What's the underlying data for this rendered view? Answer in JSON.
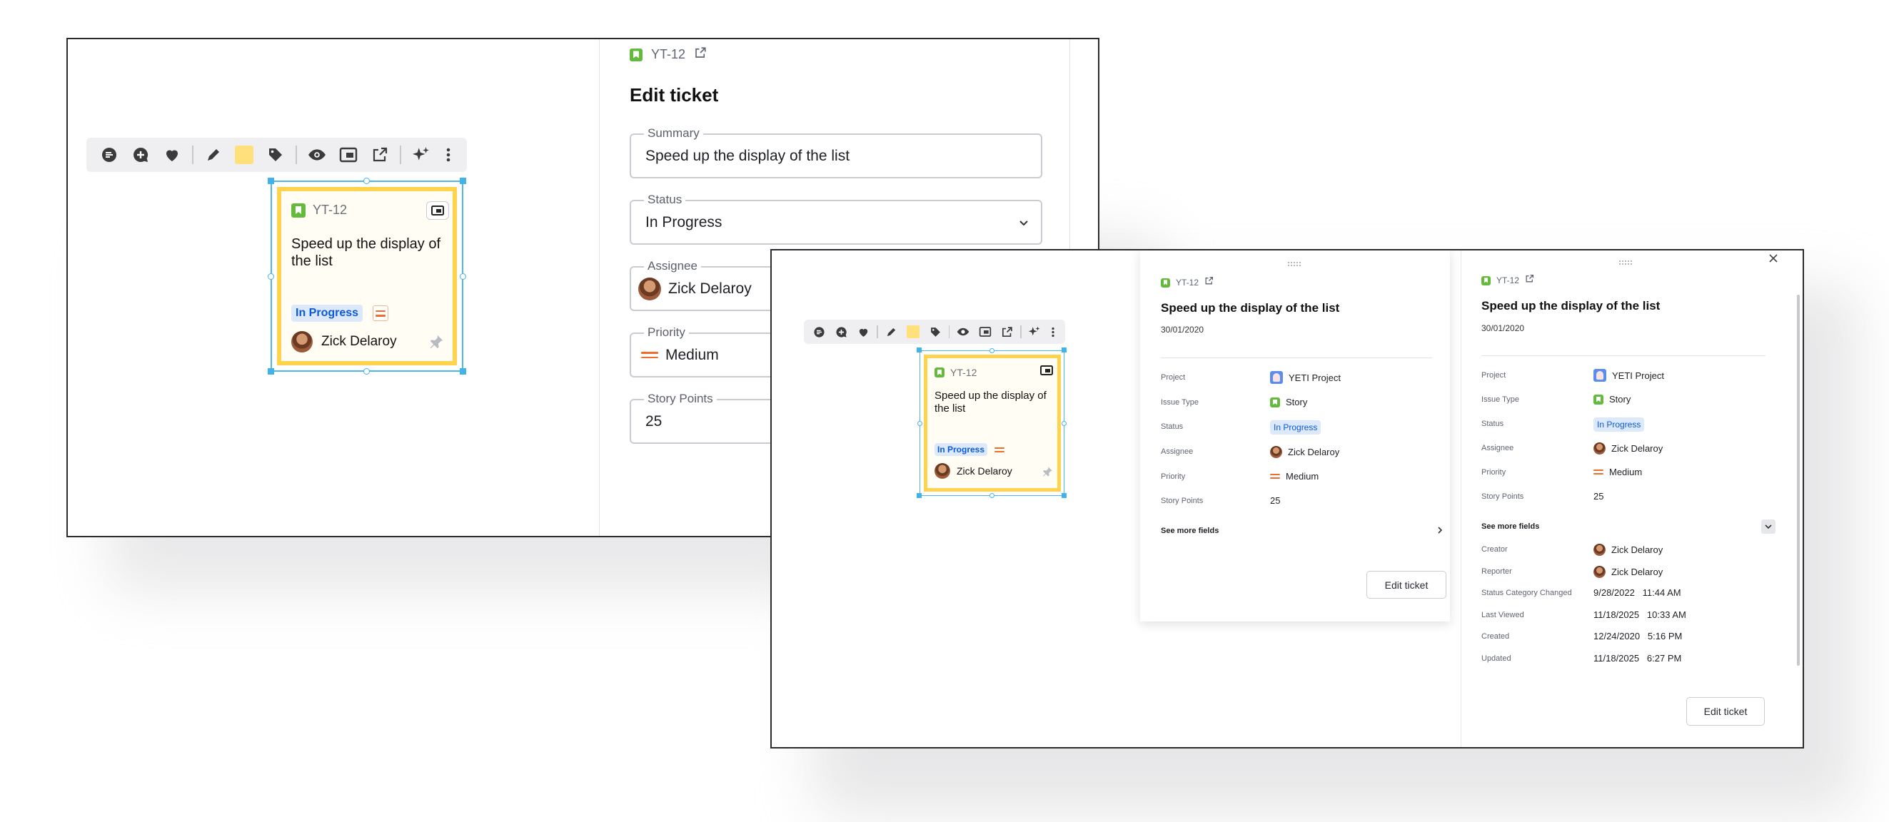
{
  "ticket": {
    "key": "YT-12",
    "title": "Speed up the display of the list",
    "date": "30/01/2020",
    "status": "In Progress",
    "assignee": "Zick Delaroy",
    "priority": "Medium",
    "story_points": "25",
    "issue_type": "Story",
    "project": "YETI Project"
  },
  "edit_form": {
    "heading": "Edit ticket",
    "summary_label": "Summary",
    "status_label": "Status",
    "assignee_label": "Assignee",
    "priority_label": "Priority",
    "story_points_label": "Story Points"
  },
  "detail_labels": {
    "project": "Project",
    "issue_type": "Issue Type",
    "status": "Status",
    "assignee": "Assignee",
    "priority": "Priority",
    "story_points": "Story Points",
    "see_more": "See more fields",
    "edit_button": "Edit ticket"
  },
  "more_fields": [
    {
      "label": "Creator",
      "value": "Zick Delaroy",
      "avatar": true
    },
    {
      "label": "Reporter",
      "value": "Zick Delaroy",
      "avatar": true
    },
    {
      "label": "Status Category Changed",
      "value": "9/28/2022   11:44 AM",
      "avatar": false
    },
    {
      "label": "Last Viewed",
      "value": "11/18/2025   10:33 AM",
      "avatar": false
    },
    {
      "label": "Created",
      "value": "12/24/2020   5:16 PM",
      "avatar": false
    },
    {
      "label": "Updated",
      "value": "11/18/2025   6:27 PM",
      "avatar": false
    }
  ],
  "toolbar_icons": [
    "dots-circle-icon",
    "add-comment-icon",
    "heart-icon",
    "pen-icon",
    "sticky-color-icon",
    "tag-icon",
    "eye-icon",
    "card-icon",
    "open-external-icon",
    "sparkle-icon",
    "more-vertical-icon"
  ],
  "colors": {
    "card_border": "#ffd34d",
    "selection": "#41b3e8",
    "story_green": "#63ba3c",
    "status_blue": "#0c5ad8",
    "priority_orange": "#f06c2c"
  }
}
